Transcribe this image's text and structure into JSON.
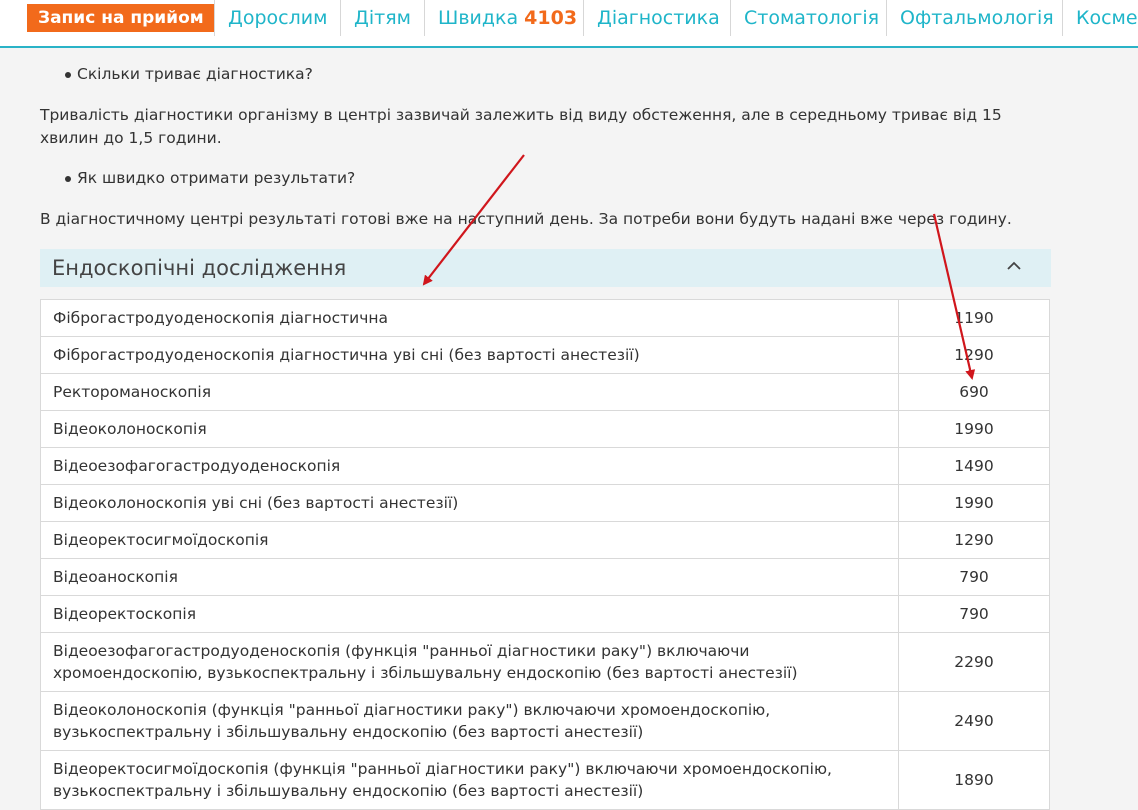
{
  "nav": {
    "cta": "Запис на прийом",
    "items": [
      "Дорослим",
      "Дітям",
      "Швидка",
      "Діагностика",
      "Стоматологія",
      "Офтальмологія",
      "Космет"
    ],
    "hotline": "4103"
  },
  "faq": {
    "q1": "Скільки триває діагностика?",
    "a1": "Тривалість діагностики організму в центрі зазвичай залежить від виду обстеження, але в середньому триває від 15 хвилин до 1,5 години.",
    "q2": "Як швидко отримати результати?",
    "a2": "В діагностичному центрі результаті готові вже на наступний день. За потреби вони будуть надані вже через годину."
  },
  "section": {
    "title": "Ендоскопічні дослідження"
  },
  "table": {
    "rows": [
      {
        "name": "Фіброгастродуоденоскопія діагностична",
        "price": "1190"
      },
      {
        "name": "Фіброгастродуоденоскопія діагностична уві сні (без вартості анестезії)",
        "price": "1290"
      },
      {
        "name": "Ректороманоскопія",
        "price": "690"
      },
      {
        "name": "Відеоколоноскопія",
        "price": "1990"
      },
      {
        "name": "Відеоезофагогастродуоденоскопія",
        "price": "1490"
      },
      {
        "name": "Відеоколоноскопія уві сні (без вартості анестезії)",
        "price": "1990"
      },
      {
        "name": "Відеоректосигмоїдоскопія",
        "price": "1290"
      },
      {
        "name": "Відеоаноскопія",
        "price": "790"
      },
      {
        "name": "Відеоректоскопія",
        "price": "790"
      },
      {
        "name": "Відеоезофагогастродуоденоскопія (функція \"ранньої діагностики раку\") включаючи хромоендоскопію, вузькоспектральну і збільшувальну ендоскопію (без вартості анестезії)",
        "price": "2290"
      },
      {
        "name": "Відеоколоноскопія (функція \"ранньої діагностики раку\") включаючи хромоендоскопію, вузькоспектральну і збільшувальну ендоскопію (без вартості анестезії)",
        "price": "2490"
      },
      {
        "name": "Відеоректосигмоїдоскопія (функція \"ранньої діагностики раку\") включаючи хромоендоскопію, вузькоспектральну і збільшувальну ендоскопію (без вартості анестезії)",
        "price": "1890"
      }
    ]
  },
  "colors": {
    "accent": "#1fb5c9",
    "cta": "#f26a1b",
    "annotation": "#d0161c"
  }
}
